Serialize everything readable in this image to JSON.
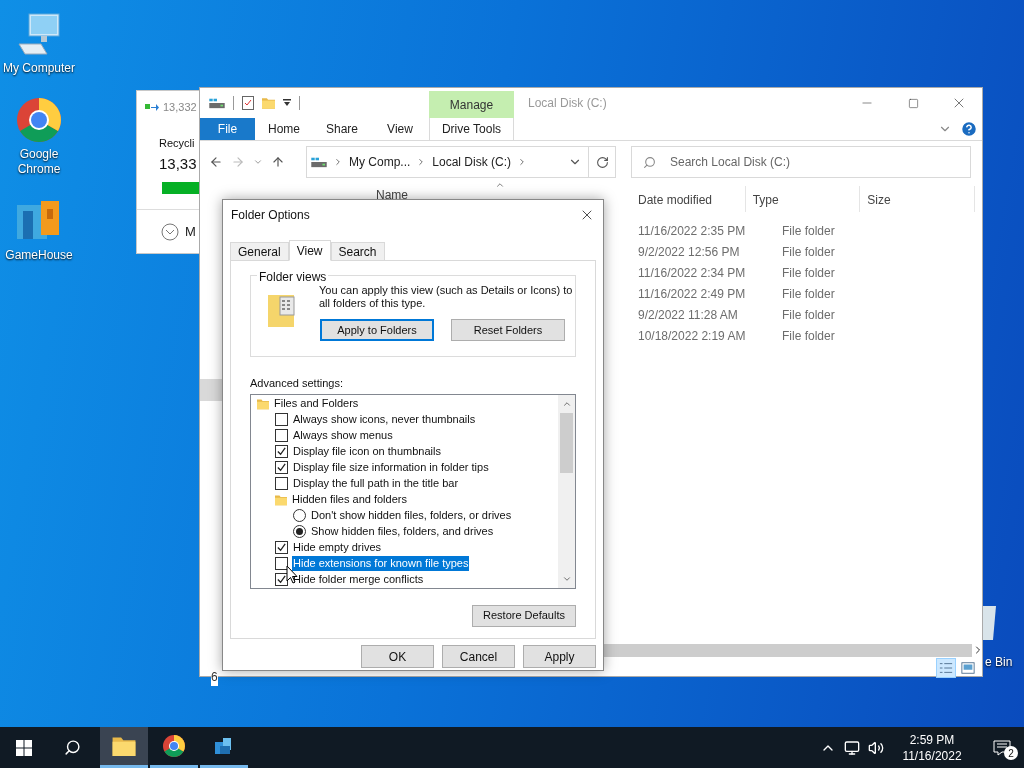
{
  "desktop_icons": [
    {
      "label": "My Computer",
      "kind": "computer"
    },
    {
      "label": "Google Chrome",
      "kind": "chrome"
    },
    {
      "label": "GameHouse",
      "kind": "gamehouse"
    }
  ],
  "recycle_bin": {
    "label": "e Bin"
  },
  "copy_dialog": {
    "header": "13,332",
    "title": "Recycli",
    "count": "13,33",
    "more": "M"
  },
  "explorer": {
    "context_tab": "Manage",
    "title": "Local Disk (C:)",
    "ribbon_tabs": [
      {
        "label": "File",
        "kind": "file"
      },
      {
        "label": "Home",
        "kind": "tab"
      },
      {
        "label": "Share",
        "kind": "tab"
      },
      {
        "label": "View",
        "kind": "tab"
      },
      {
        "label": "Drive Tools",
        "kind": "context"
      }
    ],
    "breadcrumb": [
      "My Comp...",
      "Local Disk (C:)"
    ],
    "search": {
      "placeholder": "Search Local Disk (C:)"
    },
    "columns": [
      "Name",
      "Date modified",
      "Type",
      "Size"
    ],
    "rows": [
      {
        "date": "11/16/2022 2:35 PM",
        "type": "File folder"
      },
      {
        "date": "9/2/2022 12:56 PM",
        "type": "File folder"
      },
      {
        "date": "11/16/2022 2:34 PM",
        "type": "File folder"
      },
      {
        "date": "11/16/2022 2:49 PM",
        "type": "File folder"
      },
      {
        "date": "9/2/2022 11:28 AM",
        "type": "File folder"
      },
      {
        "date": "10/18/2022 2:19 AM",
        "type": "File folder"
      }
    ],
    "status": "6"
  },
  "folder_options": {
    "title": "Folder Options",
    "tabs": [
      {
        "label": "General",
        "selected": false
      },
      {
        "label": "View",
        "selected": true
      },
      {
        "label": "Search",
        "selected": false
      }
    ],
    "folder_views": {
      "legend": "Folder views",
      "text": "You can apply this view (such as Details or Icons) to all folders of this type.",
      "buttons": [
        {
          "label": "Apply to Folders",
          "focused": true
        },
        {
          "label": "Reset Folders",
          "focused": false
        }
      ]
    },
    "advanced_label": "Advanced settings:",
    "settings": [
      {
        "kind": "folder",
        "label": "Files and Folders",
        "selected": false,
        "children": [
          {
            "kind": "checkbox",
            "label": "Always show icons, never thumbnails",
            "checked": false,
            "selected": false
          },
          {
            "kind": "checkbox",
            "label": "Always show menus",
            "checked": false,
            "selected": false
          },
          {
            "kind": "checkbox",
            "label": "Display file icon on thumbnails",
            "checked": true,
            "selected": false
          },
          {
            "kind": "checkbox",
            "label": "Display file size information in folder tips",
            "checked": true,
            "selected": false
          },
          {
            "kind": "checkbox",
            "label": "Display the full path in the title bar",
            "checked": false,
            "selected": false
          },
          {
            "kind": "folder",
            "label": "Hidden files and folders",
            "selected": false,
            "children": [
              {
                "kind": "radio",
                "label": "Don't show hidden files, folders, or drives",
                "checked": false,
                "selected": false
              },
              {
                "kind": "radio",
                "label": "Show hidden files, folders, and drives",
                "checked": true,
                "selected": false
              }
            ]
          },
          {
            "kind": "checkbox",
            "label": "Hide empty drives",
            "checked": true,
            "selected": false
          },
          {
            "kind": "checkbox",
            "label": "Hide extensions for known file types",
            "checked": false,
            "selected": true
          },
          {
            "kind": "checkbox",
            "label": "Hide folder merge conflicts",
            "checked": true,
            "selected": false
          }
        ]
      }
    ],
    "restore_button": "Restore Defaults",
    "buttons": [
      "OK",
      "Cancel",
      "Apply"
    ]
  },
  "taskbar": {
    "apps": [
      {
        "kind": "explorer",
        "active": true
      },
      {
        "kind": "chrome",
        "active": false
      },
      {
        "kind": "app",
        "active": false
      }
    ],
    "time": "2:59 PM",
    "date": "11/16/2022",
    "notifications": "2"
  }
}
